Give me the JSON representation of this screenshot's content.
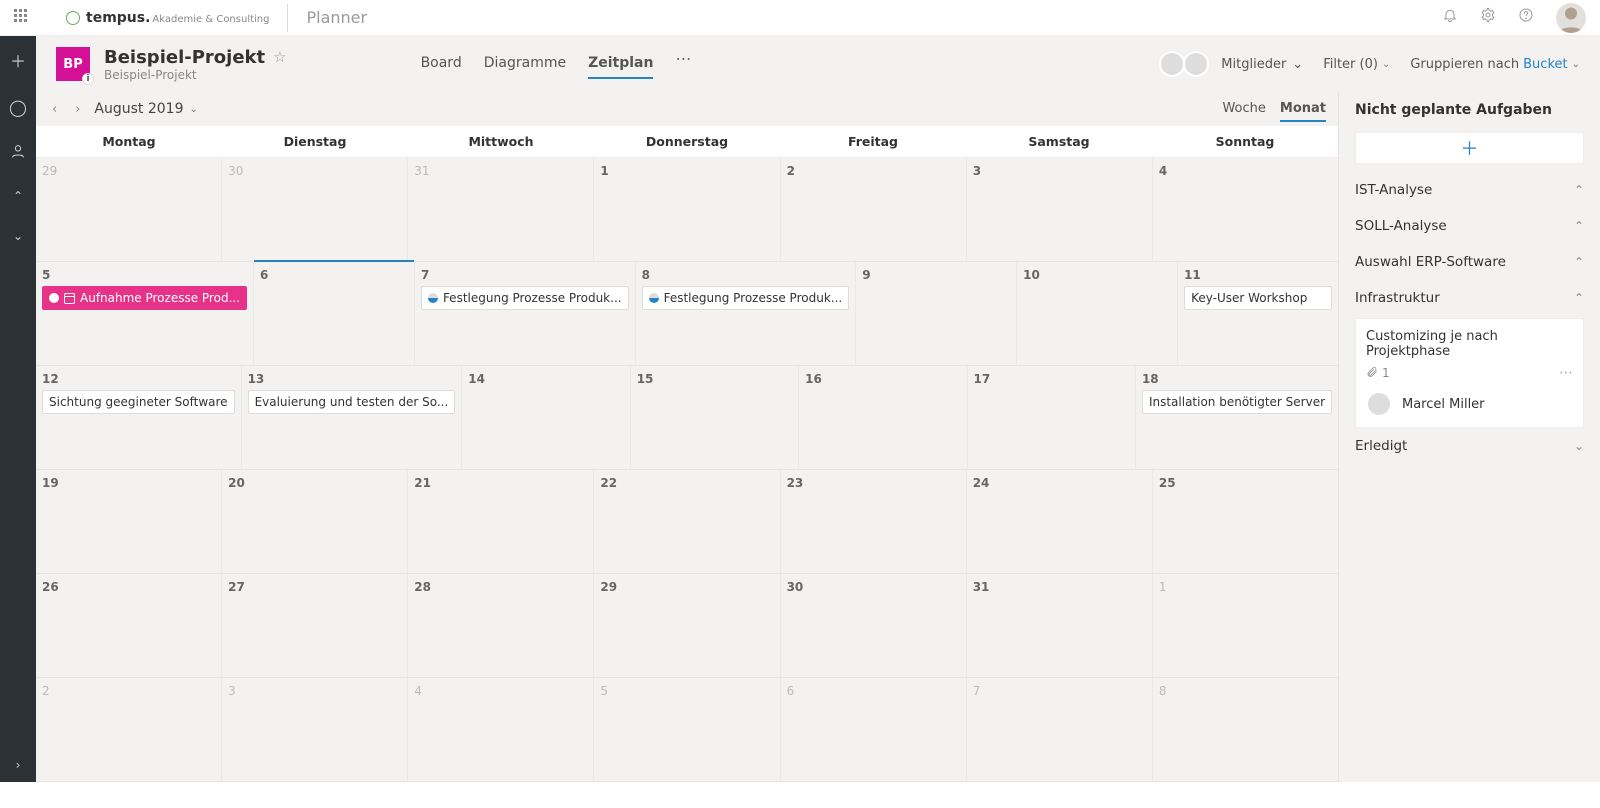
{
  "tenant": {
    "name": "tempus.",
    "sub": "Akademie & Consulting"
  },
  "app_name": "Planner",
  "project": {
    "initials": "BP",
    "title": "Beispiel-Projekt",
    "subtitle": "Beispiel-Projekt"
  },
  "pivot": {
    "board": "Board",
    "charts": "Diagramme",
    "schedule": "Zeitplan"
  },
  "toolbar": {
    "members": "Mitglieder",
    "filter": "Filter (0)",
    "group_by": "Gruppieren nach",
    "group_by_value": "Bucket"
  },
  "date_nav": {
    "label": "August 2019",
    "view_week": "Woche",
    "view_month": "Monat"
  },
  "day_names": [
    "Montag",
    "Dienstag",
    "Mittwoch",
    "Donnerstag",
    "Freitag",
    "Samstag",
    "Sonntag"
  ],
  "weeks": [
    {
      "cells": [
        {
          "n": "29",
          "other": true
        },
        {
          "n": "30",
          "other": true
        },
        {
          "n": "31",
          "other": true
        },
        {
          "n": "1",
          "bold": true
        },
        {
          "n": "2",
          "bold": true
        },
        {
          "n": "3",
          "bold": true
        },
        {
          "n": "4",
          "bold": true
        }
      ]
    },
    {
      "cells": [
        {
          "n": "5",
          "bold": true,
          "ev": {
            "text": "Aufnahme Prozesse Prod...",
            "style": "pink",
            "cal": true
          }
        },
        {
          "n": "6",
          "bold": true,
          "today": true
        },
        {
          "n": "7",
          "bold": true,
          "ev": {
            "text": "Festlegung Prozesse Produk...",
            "bucket": true
          }
        },
        {
          "n": "8",
          "bold": true,
          "ev": {
            "text": "Festlegung Prozesse Produk...",
            "bucket": true
          }
        },
        {
          "n": "9",
          "bold": true
        },
        {
          "n": "10",
          "bold": true
        },
        {
          "n": "11",
          "bold": true,
          "ev": {
            "text": "Key-User Workshop"
          }
        }
      ]
    },
    {
      "cells": [
        {
          "n": "12",
          "bold": true,
          "ev": {
            "text": "Sichtung geegineter Software"
          }
        },
        {
          "n": "13",
          "bold": true,
          "ev": {
            "text": "Evaluierung und testen der So..."
          }
        },
        {
          "n": "14",
          "bold": true
        },
        {
          "n": "15",
          "bold": true
        },
        {
          "n": "16",
          "bold": true
        },
        {
          "n": "17",
          "bold": true
        },
        {
          "n": "18",
          "bold": true,
          "ev": {
            "text": "Installation benötigter Server"
          }
        }
      ]
    },
    {
      "cells": [
        {
          "n": "19",
          "bold": true
        },
        {
          "n": "20",
          "bold": true
        },
        {
          "n": "21",
          "bold": true
        },
        {
          "n": "22",
          "bold": true
        },
        {
          "n": "23",
          "bold": true
        },
        {
          "n": "24",
          "bold": true
        },
        {
          "n": "25",
          "bold": true
        }
      ]
    },
    {
      "cells": [
        {
          "n": "26",
          "bold": true
        },
        {
          "n": "27",
          "bold": true
        },
        {
          "n": "28",
          "bold": true
        },
        {
          "n": "29",
          "bold": true
        },
        {
          "n": "30",
          "bold": true
        },
        {
          "n": "31",
          "bold": true
        },
        {
          "n": "1",
          "other": true
        }
      ]
    },
    {
      "cells": [
        {
          "n": "2",
          "other": true
        },
        {
          "n": "3",
          "other": true
        },
        {
          "n": "4",
          "other": true
        },
        {
          "n": "5",
          "other": true
        },
        {
          "n": "6",
          "other": true
        },
        {
          "n": "7",
          "other": true
        },
        {
          "n": "8",
          "other": true
        }
      ]
    }
  ],
  "side": {
    "unplanned": "Nicht geplante Aufgaben",
    "buckets": [
      {
        "name": "IST-Analyse",
        "open": true
      },
      {
        "name": "SOLL-Analyse",
        "open": true
      },
      {
        "name": "Auswahl ERP-Software",
        "open": true
      },
      {
        "name": "Infrastruktur",
        "open": true,
        "task": {
          "title": "Customizing je nach Projektphase",
          "count": "1",
          "assignee": "Marcel Miller"
        }
      },
      {
        "name": "Erledigt",
        "open": false
      }
    ]
  }
}
